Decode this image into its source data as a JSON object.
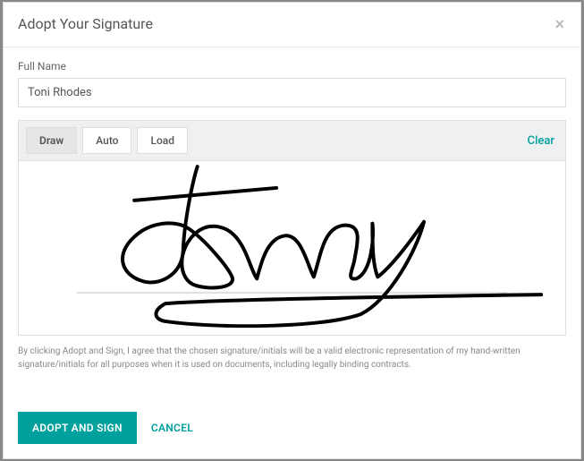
{
  "modal": {
    "title": "Adopt Your Signature",
    "close_symbol": "×",
    "fullname_label": "Full Name",
    "fullname_value": "Toni Rhodes",
    "tabs": {
      "draw": "Draw",
      "auto": "Auto",
      "load": "Load"
    },
    "clear": "Clear",
    "legal": "By clicking Adopt and Sign, I agree that the chosen signature/initials will be a valid electronic representation of my hand-written signature/initials for all purposes when it is used on documents, including legally binding contracts.",
    "adopt": "ADOPT AND SIGN",
    "cancel": "CANCEL"
  }
}
